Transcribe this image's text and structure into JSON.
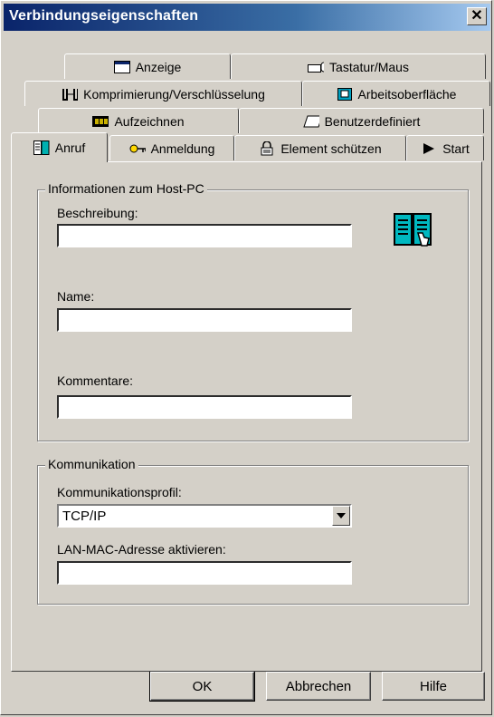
{
  "window": {
    "title": "Verbindungseigenschaften",
    "close_glyph": "✕"
  },
  "tabs": {
    "row1": [
      {
        "label": "Anzeige",
        "icon": "monitor-icon"
      },
      {
        "label": "Tastatur/Maus",
        "icon": "keyboard-mouse-icon"
      }
    ],
    "row2": [
      {
        "label": "Komprimierung/Verschlüsselung",
        "icon": "compression-icon"
      },
      {
        "label": "Arbeitsoberfläche",
        "icon": "desktop-icon"
      }
    ],
    "row3": [
      {
        "label": "Aufzeichnen",
        "icon": "record-icon"
      },
      {
        "label": "Benutzerdefiniert",
        "icon": "custom-icon"
      }
    ],
    "row4": [
      {
        "label": "Anruf",
        "icon": "phonebook-icon",
        "selected": true
      },
      {
        "label": "Anmeldung",
        "icon": "key-icon"
      },
      {
        "label": "Element schützen",
        "icon": "lock-icon"
      },
      {
        "label": "Start",
        "icon": "play-icon"
      }
    ]
  },
  "host_group": {
    "legend": "Informationen zum Host-PC",
    "description_label": "Beschreibung:",
    "description_value": "",
    "name_label": "Name:",
    "name_value": "",
    "comment_label": "Kommentare:",
    "comment_value": ""
  },
  "comm_group": {
    "legend": "Kommunikation",
    "profile_label": "Kommunikationsprofil:",
    "profile_value": "TCP/IP",
    "mac_label": "LAN-MAC-Adresse aktivieren:",
    "mac_value": ""
  },
  "buttons": {
    "ok": "OK",
    "cancel": "Abbrechen",
    "help": "Hilfe"
  }
}
